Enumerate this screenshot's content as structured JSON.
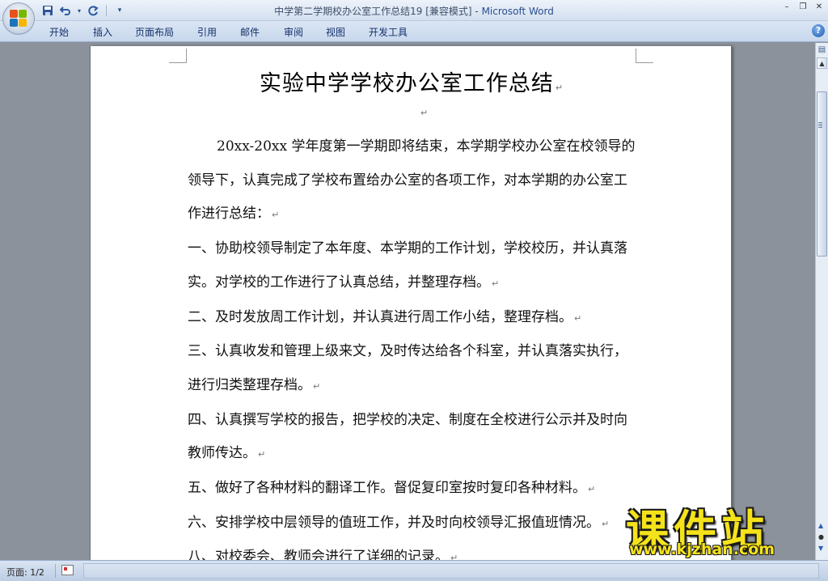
{
  "window": {
    "title_doc": "中学第二学期校办公室工作总结19 [兼容模式] - ",
    "title_app": "Microsoft Word",
    "minimize_glyph": "–",
    "restore_glyph": "❐",
    "close_glyph": "✕"
  },
  "quick_access": {
    "save_icon": "save-icon",
    "undo_icon": "undo-icon",
    "redo_icon": "redo-icon",
    "customize_icon": "chevron-down-icon"
  },
  "ribbon": {
    "tabs": [
      "开始",
      "插入",
      "页面布局",
      "引用",
      "邮件",
      "审阅",
      "视图",
      "开发工具"
    ],
    "help_glyph": "?"
  },
  "document": {
    "title": "实验中学学校办公室工作总结",
    "paragraph_mark": "↵",
    "paragraphs": [
      "20xx-20xx 学年度第一学期即将结束，本学期学校办公室在校领导的领导下，认真完成了学校布置给办公室的各项工作，对本学期的办公室工作进行总结：",
      "一、协助校领导制定了本年度、本学期的工作计划，学校校历，并认真落实。对学校的工作进行了认真总结，并整理存档。",
      "二、及时发放周工作计划，并认真进行周工作小结，整理存档。",
      "三、认真收发和管理上级来文，及时传达给各个科室，并认真落实执行，进行归类整理存档。",
      "四、认真撰写学校的报告，把学校的决定、制度在全校进行公示并及时向教师传达。",
      "五、做好了各种材料的翻译工作。督促复印室按时复印各种材料。",
      "六、安排学校中层领导的值班工作，并及时向校领导汇报值班情况。",
      "八、对校委会、教师会进行了详细的记录。"
    ]
  },
  "statusbar": {
    "page_label": "页面: 1/2"
  },
  "watermark": {
    "text": "课件站",
    "url": "www.kjzhan.com",
    "color": "#f5e31a"
  },
  "colors": {
    "ribbon_text": "#15316a",
    "workspace": "#8c929b"
  }
}
